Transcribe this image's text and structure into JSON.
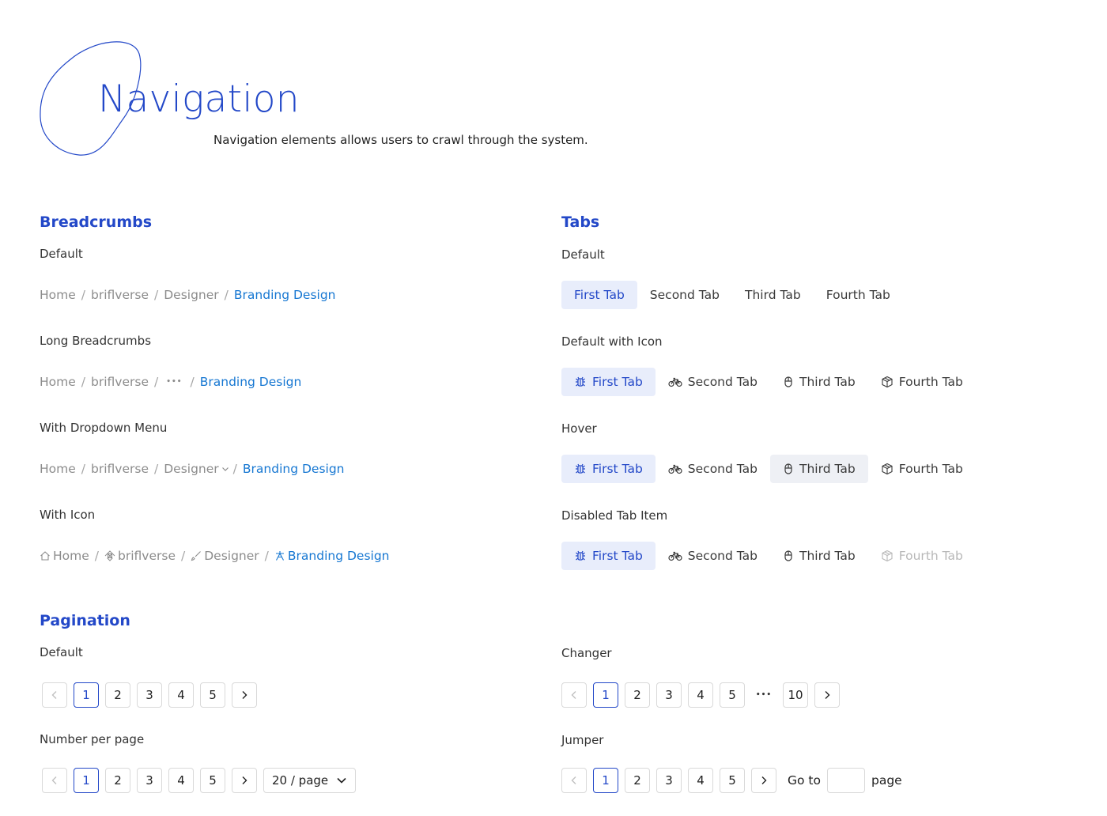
{
  "header": {
    "title": "Navigation",
    "subtitle": "Navigation elements allows users to crawl through the system."
  },
  "breadcrumbs": {
    "title": "Breadcrumbs",
    "default": {
      "label": "Default",
      "items": [
        "Home",
        "briflverse",
        "Designer",
        "Branding Design"
      ]
    },
    "long": {
      "label": "Long Breadcrumbs",
      "items": [
        "Home",
        "briflverse",
        "•••",
        "Branding Design"
      ]
    },
    "dropdown": {
      "label": "With Dropdown Menu",
      "items": [
        "Home",
        "briflverse",
        "Designer",
        "Branding Design"
      ]
    },
    "icon": {
      "label": "With Icon",
      "items": [
        "Home",
        "briflverse",
        "Designer",
        "Branding Design"
      ],
      "icons": [
        "home-icon",
        "component-icon",
        "brush-icon",
        "branch-icon"
      ]
    },
    "separator": "/"
  },
  "tabs": {
    "title": "Tabs",
    "labels": [
      "First Tab",
      "Second Tab",
      "Third Tab",
      "Fourth Tab"
    ],
    "icons": [
      "bug-icon",
      "bicycle-icon",
      "mouse-icon",
      "box-icon"
    ],
    "default": {
      "label": "Default",
      "active": 0
    },
    "with_icon": {
      "label": "Default with Icon",
      "active": 0
    },
    "hover": {
      "label": "Hover",
      "active": 0,
      "hovered": 2
    },
    "disabled": {
      "label": "Disabled Tab Item",
      "active": 0,
      "disabled": 3
    }
  },
  "pagination": {
    "title": "Pagination",
    "default": {
      "label": "Default",
      "pages": [
        "1",
        "2",
        "3",
        "4",
        "5"
      ],
      "current": "1"
    },
    "changer": {
      "label": "Changer",
      "pages": [
        "1",
        "2",
        "3",
        "4",
        "5",
        "•••",
        "10"
      ],
      "current": "1"
    },
    "per_page": {
      "label": "Number per page",
      "pages": [
        "1",
        "2",
        "3",
        "4",
        "5"
      ],
      "current": "1",
      "size": "20 / page"
    },
    "jumper": {
      "label": "Jumper",
      "pages": [
        "1",
        "2",
        "3",
        "4",
        "5"
      ],
      "current": "1",
      "go_to": "Go to",
      "page_suffix": "page",
      "input_value": ""
    }
  },
  "colors": {
    "accent": "#2348c8",
    "link": "#1677d2",
    "active_tab_bg": "#e8edfb",
    "muted": "#8c8c8c"
  }
}
